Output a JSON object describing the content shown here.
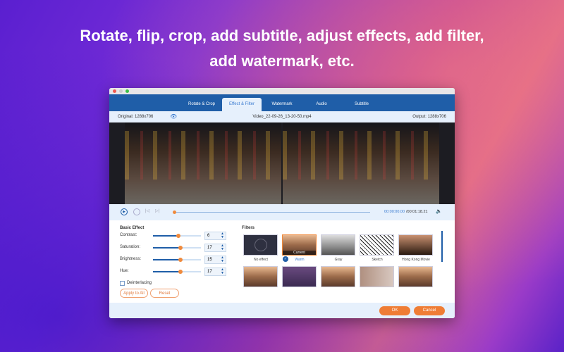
{
  "headline": {
    "line1": "Rotate, flip, crop, add subtitle, adjust effects, add filter,",
    "line2": "add watermark, etc."
  },
  "tabs": [
    {
      "label": "Rotate & Crop"
    },
    {
      "label": "Effect & Filter",
      "active": true
    },
    {
      "label": "Watermark"
    },
    {
      "label": "Audio"
    },
    {
      "label": "Subtitle"
    }
  ],
  "info": {
    "original": "Original: 1288x706",
    "filename": "Video_22-09-26_13-20-50.mp4",
    "output": "Output: 1288x706"
  },
  "player": {
    "current_time": "00:00:00.00",
    "total_time": "/00:01:18.21",
    "progress": 0
  },
  "basic_effect": {
    "title": "Basic Effect",
    "rows": [
      {
        "label": "Contrast:",
        "value": "6",
        "fraction": 0.53
      },
      {
        "label": "Saturation:",
        "value": "17",
        "fraction": 0.58
      },
      {
        "label": "Brightness:",
        "value": "15",
        "fraction": 0.57
      },
      {
        "label": "Hue:",
        "value": "17",
        "fraction": 0.58
      }
    ],
    "deinterlacing": "Deinterlacing",
    "deinterlacing_checked": false,
    "apply_all": "Apply to All",
    "reset": "Reset"
  },
  "filters": {
    "title": "Filters",
    "current_badge": "Current",
    "items": [
      {
        "label": "No effect"
      },
      {
        "label": "Warm",
        "selected": true
      },
      {
        "label": "Gray"
      },
      {
        "label": "Sketch"
      },
      {
        "label": "Hong Kong Movie"
      },
      {
        "label": ""
      },
      {
        "label": ""
      },
      {
        "label": ""
      },
      {
        "label": ""
      },
      {
        "label": ""
      }
    ]
  },
  "footer": {
    "ok": "OK",
    "cancel": "Cancel"
  },
  "colors": {
    "accent": "#f08a3c",
    "blue": "#1f5ea8",
    "panel": "#e6f0fc"
  }
}
